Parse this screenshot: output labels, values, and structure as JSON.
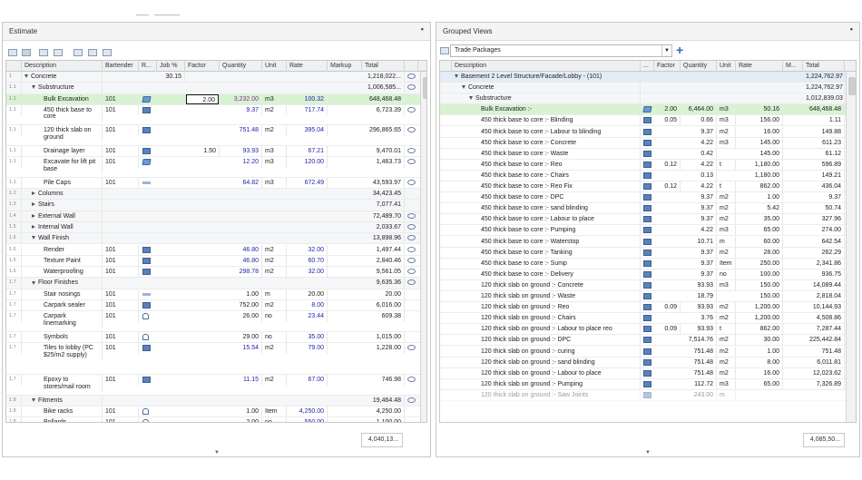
{
  "estimate": {
    "title": "Estimate",
    "footer_total": "4,040,13...",
    "headers": [
      "Description",
      "Bartender",
      "R...",
      "Job %",
      "Factor",
      "Quantity",
      "Unit",
      "Rate",
      "Markup",
      "Total"
    ],
    "editing_value": "2.00",
    "rows": [
      {
        "num": "1",
        "level": 0,
        "exp": "down",
        "desc": "Concrete",
        "job": "30.15",
        "total": "1,218,022...",
        "group": true,
        "circle": true
      },
      {
        "num": "1.1",
        "level": 1,
        "exp": "down",
        "desc": "Substructure",
        "total": "1,006,585...",
        "group": true,
        "circle": true
      },
      {
        "num": "1.1",
        "level": 2,
        "desc": "Bulk Excavation",
        "bart": "101",
        "icon": "box",
        "qty": "3,232.00",
        "qtyc": "purple",
        "unit": "m3",
        "rate": "100.32",
        "total": "648,468.48",
        "sel": true,
        "edit": true
      },
      {
        "num": "1.1",
        "level": 2,
        "desc": "450 thick base to core",
        "bart": "101",
        "icon": "doc",
        "qty": "9.37",
        "unit": "m2",
        "rate": "717.74",
        "total": "6,723.39",
        "circle": true,
        "h": 2
      },
      {
        "num": "1.1",
        "level": 2,
        "desc": "120 thick slab on ground",
        "bart": "101",
        "icon": "doc",
        "qty": "751.48",
        "unit": "m2",
        "rate": "395.04",
        "total": "296,865.65",
        "circle": true,
        "h": 2
      },
      {
        "num": "1.1",
        "level": 2,
        "desc": "Drainage layer",
        "bart": "101",
        "icon": "doc",
        "factor": "1.50",
        "qty": "93.93",
        "unit": "m3",
        "rate": "67.21",
        "total": "9,470.01",
        "circle": true
      },
      {
        "num": "1.1",
        "level": 2,
        "desc": "Excavate for lift pit base",
        "bart": "101",
        "icon": "box",
        "qty": "12.20",
        "unit": "m3",
        "rate": "120.00",
        "total": "1,463.73",
        "circle": true,
        "h": 2
      },
      {
        "num": "1.1",
        "level": 2,
        "desc": "Pile Caps",
        "bart": "101",
        "icon": "flat",
        "qty": "64.82",
        "unit": "m3",
        "rate": "672.49",
        "total": "43,593.97",
        "circle": true
      },
      {
        "num": "1.2",
        "level": 1,
        "exp": "right",
        "desc": "Columns",
        "total": "34,423.45",
        "group": true
      },
      {
        "num": "1.3",
        "level": 1,
        "exp": "right",
        "desc": "Stairs",
        "total": "7,077.41",
        "group": true
      },
      {
        "num": "1.4",
        "level": 1,
        "exp": "right",
        "desc": "External Wall",
        "total": "72,489.70",
        "group": true,
        "circle": true
      },
      {
        "num": "1.5",
        "level": 1,
        "exp": "right",
        "desc": "Internal Wall",
        "total": "2,033.67",
        "group": true,
        "circle": true
      },
      {
        "num": "1.6",
        "level": 1,
        "exp": "down",
        "desc": "Wall Finish",
        "total": "13,898.96",
        "group": true,
        "circle": true
      },
      {
        "num": "1.6",
        "level": 2,
        "desc": "Render",
        "bart": "101",
        "icon": "doc",
        "qty": "46.80",
        "unit": "m2",
        "rate": "32.00",
        "total": "1,497.44",
        "circle": true
      },
      {
        "num": "1.6",
        "level": 2,
        "desc": "Texture Paint",
        "bart": "101",
        "icon": "doc",
        "qty": "46.80",
        "unit": "m2",
        "rate": "60.70",
        "total": "2,840.46",
        "circle": true
      },
      {
        "num": "1.6",
        "level": 2,
        "desc": "Waterproofing",
        "bart": "101",
        "icon": "doc",
        "qty": "298.78",
        "unit": "m2",
        "rate": "32.00",
        "total": "9,561.05",
        "circle": true
      },
      {
        "num": "1.7",
        "level": 1,
        "exp": "down",
        "desc": "Floor Finishes",
        "total": "9,635.36",
        "group": true,
        "circle": true
      },
      {
        "num": "1.7",
        "level": 2,
        "desc": "Stair nosings",
        "bart": "101",
        "icon": "flat",
        "qty": "1.00",
        "qtyc": "plain",
        "unit": "m",
        "rate": "20.00",
        "ratec": "plain",
        "total": "20.00"
      },
      {
        "num": "1.7",
        "level": 2,
        "desc": "Carpark sealer",
        "bart": "101",
        "icon": "doc",
        "qty": "752.00",
        "qtyc": "plain",
        "unit": "m2",
        "rate": "8.00",
        "total": "6,016.00"
      },
      {
        "num": "1.7",
        "level": 2,
        "desc": "Carpark linemarking",
        "bart": "101",
        "icon": "hand",
        "qty": "26.00",
        "qtyc": "plain",
        "unit": "no",
        "rate": "23.44",
        "total": "609.38",
        "h": 2
      },
      {
        "num": "1.7",
        "level": 2,
        "desc": "Symbols",
        "bart": "101",
        "icon": "hand",
        "qty": "29.00",
        "qtyc": "plain",
        "unit": "no",
        "rate": "35.00",
        "total": "1,015.00"
      },
      {
        "num": "1.7",
        "level": 2,
        "desc": "Tiles to lobby (PC $25/m2 supply)",
        "bart": "101",
        "icon": "doc",
        "qty": "15.54",
        "unit": "m2",
        "rate": "79.00",
        "total": "1,228.00",
        "circle": true,
        "h": 4
      },
      {
        "num": "1.7",
        "level": 2,
        "desc": "Epoxy to stores/mail room",
        "bart": "101",
        "icon": "doc",
        "qty": "11.15",
        "unit": "m2",
        "rate": "67.00",
        "total": "746.98",
        "circle": true,
        "h": 2
      },
      {
        "num": "1.8",
        "level": 1,
        "exp": "down",
        "desc": "Fitments",
        "total": "19,464.48",
        "group": true,
        "circle": true
      },
      {
        "num": "1.8",
        "level": 2,
        "desc": "Bike racks",
        "bart": "101",
        "icon": "hand",
        "qty": "1.00",
        "qtyc": "plain",
        "unit": "Item",
        "rate": "4,250.00",
        "total": "4,250.00"
      },
      {
        "num": "1.8",
        "level": 2,
        "desc": "Bollards",
        "bart": "101",
        "icon": "hand",
        "qty": "2.00",
        "qtyc": "plain",
        "unit": "no",
        "rate": "550.00",
        "total": "1,100.00"
      },
      {
        "num": "1.8",
        "level": 2,
        "desc": "Roller shutter",
        "bart": "101",
        "icon": "doc",
        "qty": "1.00",
        "qtyc": "plain",
        "unit": "m2",
        "rate": "200.00",
        "total": "200.00"
      },
      {
        "num": "1.8",
        "level": 2,
        "desc": "Roller Grille",
        "bart": "101",
        "icon": "doc",
        "qty": "29.88",
        "unit": "m2",
        "rate": "454.00",
        "total": "13,564.48",
        "circle": true
      }
    ]
  },
  "grouped": {
    "title": "Grouped Views",
    "dropdown_value": "Trade Packages",
    "footer_total": "4,085,50...",
    "headers": [
      "Description",
      "...",
      "Factor",
      "Quantity",
      "Unit",
      "Rate",
      "M...",
      "Total"
    ],
    "rows": [
      {
        "level": 0,
        "exp": "down",
        "desc": "Basement 2 Level Structure/Facade/Lobby - (101)",
        "total": "1,224,762.97",
        "top": true
      },
      {
        "level": 1,
        "exp": "down",
        "desc": "Concrete",
        "total": "1,224,762.97",
        "group": true
      },
      {
        "level": 2,
        "exp": "down",
        "desc": "Substructure",
        "total": "1,012,839.03",
        "group": true
      },
      {
        "level": 3,
        "desc": "Bulk Excavation :-",
        "icon": "box",
        "factor": "2.00",
        "qty": "6,464.00",
        "unit": "m3",
        "rate": "50.16",
        "total": "648,468.48",
        "sel": true
      },
      {
        "level": 3,
        "desc": "450 thick base to core :- Blinding",
        "icon": "doc",
        "factor": "0.05",
        "qty": "0.66",
        "unit": "m3",
        "rate": "156.00",
        "total": "1.11"
      },
      {
        "level": 3,
        "desc": "450 thick base to core :- Labour to blinding",
        "icon": "doc",
        "qty": "9.37",
        "unit": "m2",
        "rate": "16.00",
        "total": "149.88"
      },
      {
        "level": 3,
        "desc": "450 thick base to core :- Concrete",
        "icon": "doc",
        "qty": "4.22",
        "unit": "m3",
        "rate": "145.00",
        "total": "611.23"
      },
      {
        "level": 3,
        "desc": "450 thick base to core :- Waste",
        "icon": "doc",
        "qty": "0.42",
        "unit": "",
        "rate": "145.00",
        "total": "61.12"
      },
      {
        "level": 3,
        "desc": "450 thick base to core :- Reo",
        "icon": "doc",
        "factor": "0.12",
        "qty": "4.22",
        "unit": "t",
        "rate": "1,180.00",
        "total": "596.89"
      },
      {
        "level": 3,
        "desc": "450 thick base to core :- Chairs",
        "icon": "doc",
        "qty": "0.13",
        "unit": "",
        "rate": "1,180.00",
        "total": "149.21"
      },
      {
        "level": 3,
        "desc": "450 thick base to core :- Reo Fix",
        "icon": "doc",
        "factor": "0.12",
        "qty": "4.22",
        "unit": "t",
        "rate": "862.00",
        "total": "436.04"
      },
      {
        "level": 3,
        "desc": "450 thick base to core :- DPC",
        "icon": "doc",
        "qty": "9.37",
        "unit": "m2",
        "rate": "1.00",
        "total": "9.37"
      },
      {
        "level": 3,
        "desc": "450 thick base to core :- sand blinding",
        "icon": "doc",
        "qty": "9.37",
        "unit": "m2",
        "rate": "5.42",
        "total": "50.74"
      },
      {
        "level": 3,
        "desc": "450 thick base to core :- Labour to place",
        "icon": "doc",
        "qty": "9.37",
        "unit": "m2",
        "rate": "35.00",
        "total": "327.96"
      },
      {
        "level": 3,
        "desc": "450 thick base to core :- Pumping",
        "icon": "doc",
        "qty": "4.22",
        "unit": "m3",
        "rate": "65.00",
        "total": "274.00"
      },
      {
        "level": 3,
        "desc": "450 thick base to core :- Waterstop",
        "icon": "doc",
        "qty": "10.71",
        "unit": "m",
        "rate": "60.00",
        "total": "642.54"
      },
      {
        "level": 3,
        "desc": "450 thick base to core :- Tanking",
        "icon": "doc",
        "qty": "9.37",
        "unit": "m2",
        "rate": "28.00",
        "total": "262.29"
      },
      {
        "level": 3,
        "desc": "450 thick base to core :- Sump",
        "icon": "doc",
        "qty": "9.37",
        "unit": "Item",
        "rate": "250.00",
        "total": "2,341.86"
      },
      {
        "level": 3,
        "desc": "450 thick base to core :- Delivery",
        "icon": "doc",
        "qty": "9.37",
        "unit": "no",
        "rate": "100.00",
        "total": "936.75"
      },
      {
        "level": 3,
        "desc": "120 thick slab on ground :- Concrete",
        "icon": "doc",
        "qty": "93.93",
        "unit": "m3",
        "rate": "150.00",
        "total": "14,089.44"
      },
      {
        "level": 3,
        "desc": "120 thick slab on ground :- Waste",
        "icon": "doc",
        "qty": "18.79",
        "unit": "",
        "rate": "150.00",
        "total": "2,818.04"
      },
      {
        "level": 3,
        "desc": "120 thick slab on ground :- Reo",
        "icon": "doc",
        "factor": "0.09",
        "qty": "93.93",
        "unit": "m2",
        "rate": "1,200.00",
        "total": "10,144.93"
      },
      {
        "level": 3,
        "desc": "120 thick slab on ground :- Chairs",
        "icon": "doc",
        "qty": "3.76",
        "unit": "m2",
        "rate": "1,200.00",
        "total": "4,508.86"
      },
      {
        "level": 3,
        "desc": "120 thick slab on ground :- Labour to place reo",
        "icon": "doc",
        "factor": "0.09",
        "qty": "93.93",
        "unit": "t",
        "rate": "862.00",
        "total": "7,287.44"
      },
      {
        "level": 3,
        "desc": "120 thick slab on ground :- DPC",
        "icon": "doc",
        "qty": "7,514.76",
        "unit": "m2",
        "rate": "30.00",
        "total": "225,442.84"
      },
      {
        "level": 3,
        "desc": "120 thick slab on ground :- curing",
        "icon": "doc",
        "qty": "751.48",
        "unit": "m2",
        "rate": "1.00",
        "total": "751.48"
      },
      {
        "level": 3,
        "desc": "120 thick slab on ground :- sand blinding",
        "icon": "doc",
        "qty": "751.48",
        "unit": "m2",
        "rate": "8.00",
        "total": "6,011.81"
      },
      {
        "level": 3,
        "desc": "120 thick slab on ground :- Labour to place",
        "icon": "doc",
        "qty": "751.48",
        "unit": "m2",
        "rate": "16.00",
        "total": "12,023.62"
      },
      {
        "level": 3,
        "desc": "120 thick slab on ground :- Pumping",
        "icon": "doc",
        "qty": "112.72",
        "unit": "m3",
        "rate": "65.00",
        "total": "7,326.89"
      },
      {
        "level": 3,
        "desc": "120 thick slab on ground :- Saw Joints",
        "icon": "doc",
        "qty": "243.00",
        "unit": "m",
        "rate": "",
        "total": "",
        "partial": true
      }
    ]
  }
}
